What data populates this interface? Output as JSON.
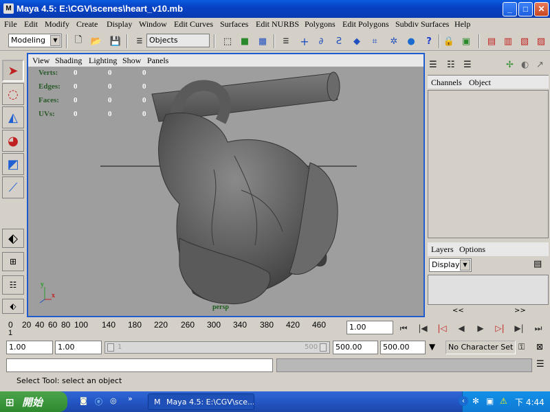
{
  "window": {
    "title": "Maya 4.5: E:\\CGV\\scenes\\heart_v10.mb",
    "minimize": "_",
    "maximize": "□",
    "close": "✕"
  },
  "menu": [
    "File",
    "Edit",
    "Modify",
    "Create",
    "Display",
    "Window",
    "Edit Curves",
    "Surfaces",
    "Edit NURBS",
    "Polygons",
    "Edit Polygons",
    "Subdiv Surfaces",
    "Help"
  ],
  "toolbar": {
    "mode_value": "Modeling",
    "selection_field": "Objects"
  },
  "viewport": {
    "menu": [
      "View",
      "Shading",
      "Lighting",
      "Show",
      "Panels"
    ],
    "hud": {
      "labels": [
        "Verts:",
        "Edges:",
        "Faces:",
        "UVs:"
      ],
      "values": [
        [
          "0",
          "0",
          "0"
        ],
        [
          "0",
          "0",
          "0"
        ],
        [
          "0",
          "0",
          "0"
        ],
        [
          "0",
          "0",
          "0"
        ]
      ]
    },
    "camera_label": "persp",
    "axis_y": "y",
    "axis_x": "x"
  },
  "channel_box": {
    "tab_channels": "Channels",
    "tab_object": "Object"
  },
  "layers": {
    "tab_layers": "Layers",
    "tab_options": "Options",
    "display_value": "Display",
    "scroll_left": "<<",
    "scroll_right": ">>"
  },
  "timeline": {
    "ticks": [
      "0",
      "20",
      "40",
      "60",
      "80",
      "100",
      "140",
      "180",
      "220",
      "260",
      "300",
      "340",
      "380",
      "420",
      "460"
    ],
    "current_frame": "1.00",
    "current_marker": "1"
  },
  "range": {
    "start": "1.00",
    "playback_start": "1.00",
    "slider_left": "1",
    "slider_right": "500",
    "playback_end": "500.00",
    "end": "500.00",
    "character_set": "No Character Set"
  },
  "help_line": "Select Tool: select an object",
  "taskbar": {
    "start_label": "開始",
    "task_item": "Maya 4.5: E:\\CGV\\sce...",
    "more": "»",
    "clock": "下 4:44"
  },
  "colors": {
    "titlebar": "#0842c4",
    "viewport_bg": "#9e9e9e",
    "viewport_border": "#1e5ad0",
    "taskbar": "#2456c5",
    "start": "#2f8a2f"
  }
}
